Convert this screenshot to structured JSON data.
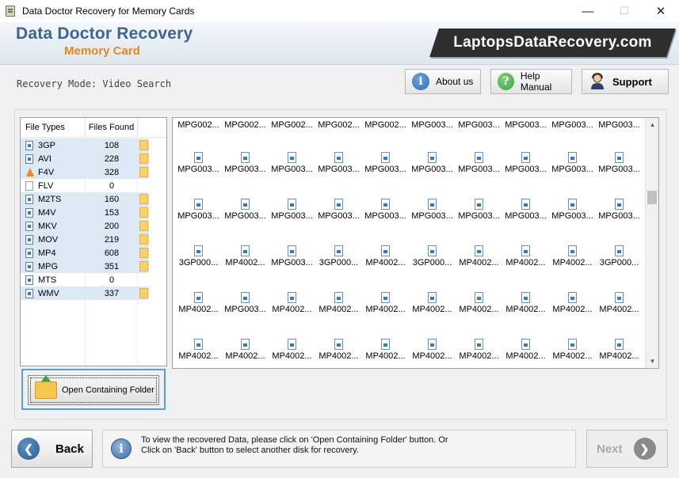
{
  "window": {
    "title": "Data Doctor Recovery for Memory Cards",
    "minimize_glyph": "—",
    "maximize_glyph": "☐",
    "close_glyph": "✕"
  },
  "header": {
    "brand_line1": "Data Doctor Recovery",
    "brand_line2": "Memory Card",
    "site": "LaptopsDataRecovery.com"
  },
  "mode": {
    "label": "Recovery Mode: Video Search"
  },
  "toolbar": {
    "about_label": "About us",
    "help_label": "Help Manual",
    "support_label": "Support",
    "about_icon": "i",
    "help_icon": "?"
  },
  "file_types": {
    "col_type": "File Types",
    "col_count": "Files Found",
    "rows": [
      {
        "name": "3GP",
        "count": "108",
        "icon": "video-file-icon",
        "folder": true
      },
      {
        "name": "AVI",
        "count": "228",
        "icon": "video-file-icon",
        "folder": true
      },
      {
        "name": "F4V",
        "count": "328",
        "icon": "vlc-cone-icon",
        "folder": true
      },
      {
        "name": "FLV",
        "count": "0",
        "icon": "blank-file-icon",
        "folder": false
      },
      {
        "name": "M2TS",
        "count": "160",
        "icon": "video-file-icon",
        "folder": true
      },
      {
        "name": "M4V",
        "count": "153",
        "icon": "video-file-icon",
        "folder": true
      },
      {
        "name": "MKV",
        "count": "200",
        "icon": "video-file-icon",
        "folder": true
      },
      {
        "name": "MOV",
        "count": "219",
        "icon": "video-file-icon",
        "folder": true
      },
      {
        "name": "MP4",
        "count": "608",
        "icon": "video-file-icon",
        "folder": true
      },
      {
        "name": "MPG",
        "count": "351",
        "icon": "video-file-icon",
        "folder": true
      },
      {
        "name": "MTS",
        "count": "0",
        "icon": "video-file-icon",
        "folder": false
      },
      {
        "name": "WMV",
        "count": "337",
        "icon": "video-file-icon",
        "folder": true
      }
    ]
  },
  "open_folder_label": "Open Containing Folder",
  "files": {
    "first_row": [
      "MPG002...",
      "MPG002...",
      "MPG002...",
      "MPG002...",
      "MPG002...",
      "MPG003...",
      "MPG003...",
      "MPG003...",
      "MPG003...",
      "MPG003..."
    ],
    "rows": [
      [
        "MPG003...",
        "MPG003...",
        "MPG003...",
        "MPG003...",
        "MPG003...",
        "MPG003...",
        "MPG003...",
        "MPG003...",
        "MPG003...",
        "MPG003..."
      ],
      [
        "MPG003...",
        "MPG003...",
        "MPG003...",
        "MPG003...",
        "MPG003...",
        "MPG003...",
        "MPG003...",
        "MPG003...",
        "MPG003...",
        "MPG003..."
      ],
      [
        "3GP000...",
        "MP4002...",
        "MPG003...",
        "3GP000...",
        "MP4002...",
        "3GP000...",
        "MP4002...",
        "MP4002...",
        "MP4002...",
        "3GP000..."
      ],
      [
        "MP4002...",
        "MPG003...",
        "MP4002...",
        "MP4002...",
        "MP4002...",
        "MP4002...",
        "MP4002...",
        "MP4002...",
        "MP4002...",
        "MP4002..."
      ],
      [
        "MP4002...",
        "MP4002...",
        "MP4002...",
        "MP4002...",
        "MP4002...",
        "MP4002...",
        "MP4002...",
        "MP4002...",
        "MP4002...",
        "MP4002..."
      ]
    ]
  },
  "bottom": {
    "back_label": "Back",
    "next_label": "Next",
    "info_line1": "To view the recovered Data, please click on 'Open Containing Folder' button. Or",
    "info_line2": "Click on 'Back' button to select another disk for recovery."
  },
  "colors": {
    "brand_blue": "#3c6596",
    "brand_orange": "#e58a1a",
    "about_blue": "#2f6db0",
    "help_green": "#3aa63a",
    "selection": "#dce8f4"
  }
}
